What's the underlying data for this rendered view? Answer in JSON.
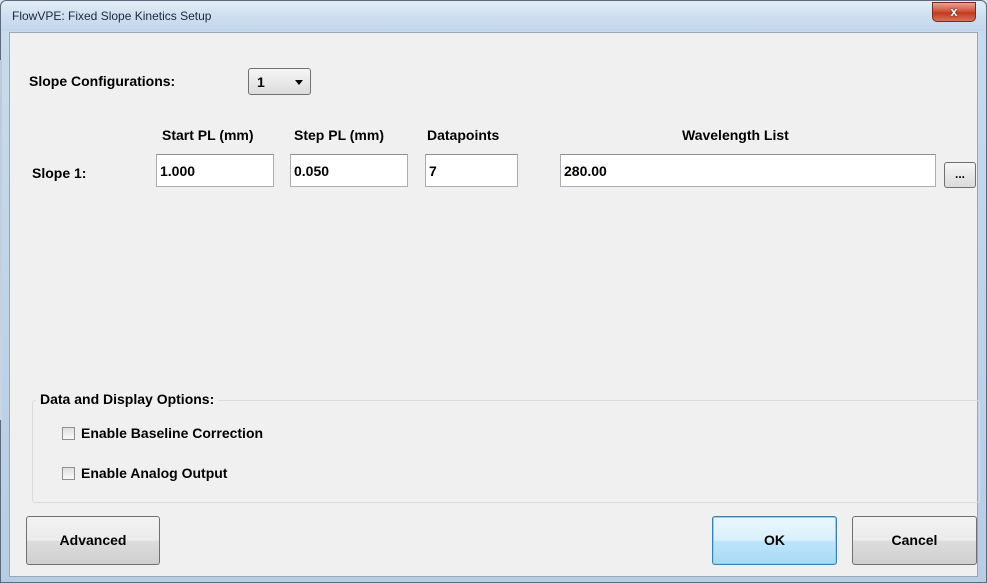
{
  "window": {
    "title": "FlowVPE: Fixed Slope Kinetics Setup",
    "close_icon": "close-icon",
    "close_glyph": "x"
  },
  "slope_config": {
    "label": "Slope Configurations:",
    "selected": "1"
  },
  "columns": {
    "start_pl": "Start PL (mm)",
    "step_pl": "Step PL (mm)",
    "datapoints": "Datapoints",
    "wavelength_list": "Wavelength List"
  },
  "slopes": [
    {
      "label": "Slope 1:",
      "start_pl": "1.000",
      "step_pl": "0.050",
      "datapoints": "7",
      "wavelengths": "280.00",
      "browse_label": "..."
    }
  ],
  "options": {
    "title": "Data and Display Options:",
    "baseline_correction": {
      "label": "Enable Baseline Correction",
      "checked": false
    },
    "analog_output": {
      "label": "Enable Analog Output",
      "checked": false
    }
  },
  "buttons": {
    "advanced": "Advanced",
    "ok": "OK",
    "cancel": "Cancel"
  },
  "colors": {
    "close_button": "#c8462c",
    "default_button": "#3c7fb1",
    "client_bg": "#f0f0f0"
  }
}
